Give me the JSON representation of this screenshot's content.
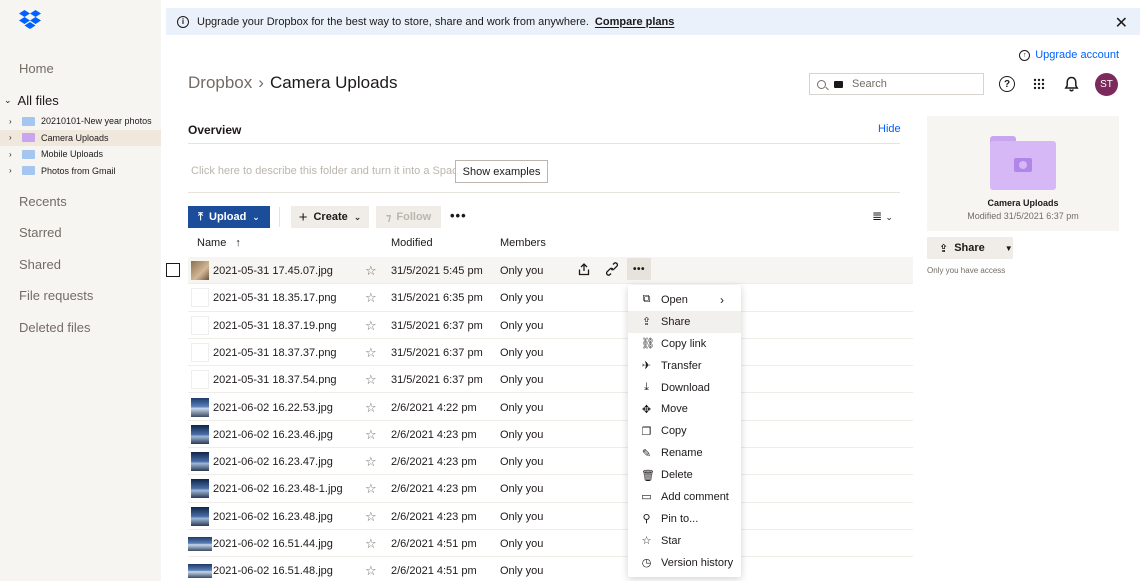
{
  "sidebar": {
    "nav": [
      "Home",
      "All files",
      "Recents",
      "Starred",
      "Shared",
      "File requests",
      "Deleted files"
    ],
    "tree": [
      {
        "label": "20210101-New year photos",
        "color": "blue"
      },
      {
        "label": "Camera Uploads",
        "color": "purple",
        "selected": true
      },
      {
        "label": "Mobile Uploads",
        "color": "blue"
      },
      {
        "label": "Photos from Gmail",
        "color": "blue"
      }
    ]
  },
  "banner": {
    "text": "Upgrade your Dropbox for the best way to store, share and work from anywhere.",
    "link": "Compare plans",
    "close": "✕"
  },
  "header": {
    "upgrade": "Upgrade account",
    "breadcrumb_root": "Dropbox",
    "breadcrumb_sep": "›",
    "breadcrumb_current": "Camera Uploads",
    "search_placeholder": "Search",
    "avatar": "ST"
  },
  "overview": {
    "title": "Overview",
    "hide": "Hide",
    "describe": "Click here to describe this folder and turn it into a Space",
    "show_examples": "Show examples"
  },
  "toolbar": {
    "upload": "Upload",
    "create": "Create",
    "follow": "Follow"
  },
  "table": {
    "headers": {
      "name": "Name",
      "modified": "Modified",
      "members": "Members"
    },
    "rows": [
      {
        "name": "2021-05-31 17.45.07.jpg",
        "modified": "31/5/2021 5:45 pm",
        "members": "Only you",
        "thumb": "cat"
      },
      {
        "name": "2021-05-31 18.35.17.png",
        "modified": "31/5/2021 6:35 pm",
        "members": "Only you",
        "thumb": "doc"
      },
      {
        "name": "2021-05-31 18.37.19.png",
        "modified": "31/5/2021 6:37 pm",
        "members": "Only you",
        "thumb": "doc"
      },
      {
        "name": "2021-05-31 18.37.37.png",
        "modified": "31/5/2021 6:37 pm",
        "members": "Only you",
        "thumb": "doc"
      },
      {
        "name": "2021-05-31 18.37.54.png",
        "modified": "31/5/2021 6:37 pm",
        "members": "Only you",
        "thumb": "doc"
      },
      {
        "name": "2021-06-02 16.22.53.jpg",
        "modified": "2/6/2021 4:22 pm",
        "members": "Only you",
        "thumb": "photo"
      },
      {
        "name": "2021-06-02 16.23.46.jpg",
        "modified": "2/6/2021 4:23 pm",
        "members": "Only you",
        "thumb": "photo2"
      },
      {
        "name": "2021-06-02 16.23.47.jpg",
        "modified": "2/6/2021 4:23 pm",
        "members": "Only you",
        "thumb": "photo2"
      },
      {
        "name": "2021-06-02 16.23.48-1.jpg",
        "modified": "2/6/2021 4:23 pm",
        "members": "Only you",
        "thumb": "photo2"
      },
      {
        "name": "2021-06-02 16.23.48.jpg",
        "modified": "2/6/2021 4:23 pm",
        "members": "Only you",
        "thumb": "photo2"
      },
      {
        "name": "2021-06-02 16.51.44.jpg",
        "modified": "2/6/2021 4:51 pm",
        "members": "Only you",
        "thumb": "wide"
      },
      {
        "name": "2021-06-02 16.51.48.jpg",
        "modified": "2/6/2021 4:51 pm",
        "members": "Only you",
        "thumb": "wide"
      }
    ]
  },
  "menu": [
    {
      "label": "Open",
      "icon": "open-icon",
      "glyph": "⧉",
      "submenu": true
    },
    {
      "label": "Share",
      "icon": "share-icon",
      "glyph": "⇪",
      "hover": true
    },
    {
      "label": "Copy link",
      "icon": "link-icon",
      "glyph": "⛓"
    },
    {
      "label": "Transfer",
      "icon": "transfer-icon",
      "glyph": "✈"
    },
    {
      "label": "Download",
      "icon": "download-icon",
      "glyph": "⤓"
    },
    {
      "label": "Move",
      "icon": "move-icon",
      "glyph": "✥"
    },
    {
      "label": "Copy",
      "icon": "copy-icon",
      "glyph": "❐"
    },
    {
      "label": "Rename",
      "icon": "rename-icon",
      "glyph": "✎"
    },
    {
      "label": "Delete",
      "icon": "delete-icon",
      "glyph": "🗑"
    },
    {
      "label": "Add comment",
      "icon": "comment-icon",
      "glyph": "▭"
    },
    {
      "label": "Pin to...",
      "icon": "pin-icon",
      "glyph": "⚲"
    },
    {
      "label": "Star",
      "icon": "star-icon",
      "glyph": "☆"
    },
    {
      "label": "Version history",
      "icon": "history-icon",
      "glyph": "◷"
    }
  ],
  "details": {
    "name": "Camera Uploads",
    "modified": "Modified 31/5/2021 6:37 pm",
    "share": "Share",
    "access": "Only you have access"
  },
  "colors": {
    "accent": "#0061fe",
    "upload_bg": "#1b4d9b",
    "avatar": "#7b2a5b",
    "folder_purple": "#d5b8f5"
  }
}
